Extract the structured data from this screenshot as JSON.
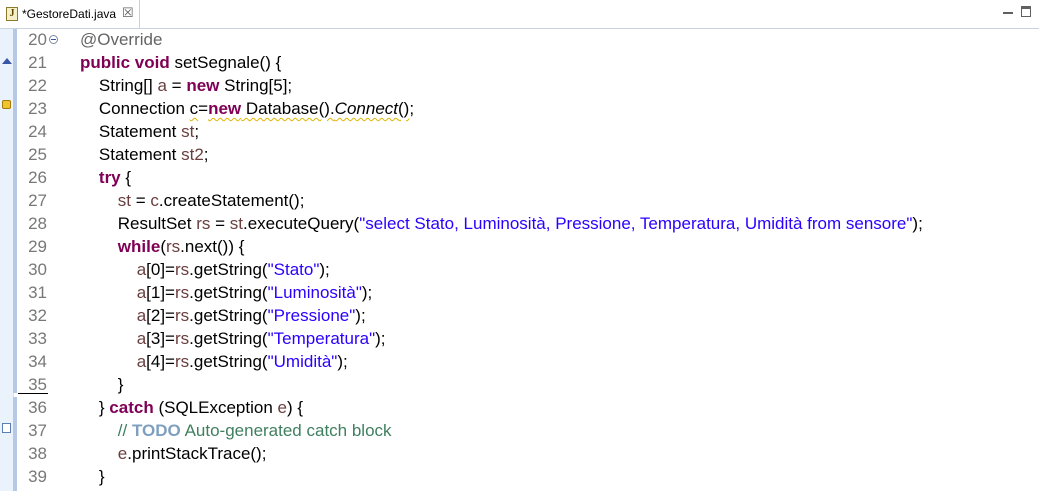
{
  "tab": {
    "title": "*GestoreDati.java",
    "icon": "java-file-icon",
    "close_glyph": "☒"
  },
  "window_controls": [
    "minimize-icon",
    "maximize-icon"
  ],
  "lines": [
    {
      "num": "20",
      "fold": true,
      "tokens": [
        [
          "ann",
          "@Override"
        ]
      ]
    },
    {
      "num": "21",
      "tokens": [
        [
          "kw",
          "public"
        ],
        [
          "",
          " "
        ],
        [
          "kw",
          "void"
        ],
        [
          "",
          " setSegnale() {"
        ]
      ]
    },
    {
      "num": "22",
      "tokens": [
        [
          "",
          "    String[] "
        ],
        [
          "var",
          "a"
        ],
        [
          "",
          " = "
        ],
        [
          "kw",
          "new"
        ],
        [
          "",
          " String[5];"
        ]
      ]
    },
    {
      "num": "23",
      "tokens": [
        [
          "",
          "    Connection "
        ],
        [
          "squig",
          "c"
        ],
        [
          "",
          "="
        ],
        [
          "kw squig",
          "new"
        ],
        [
          "squig",
          " Database()."
        ],
        [
          "ital squig",
          "Connect"
        ],
        [
          "squig",
          "()"
        ],
        [
          "",
          ";"
        ]
      ]
    },
    {
      "num": "24",
      "tokens": [
        [
          "",
          "    Statement "
        ],
        [
          "var",
          "st"
        ],
        [
          "",
          ";"
        ]
      ]
    },
    {
      "num": "25",
      "tokens": [
        [
          "",
          "    Statement "
        ],
        [
          "var",
          "st2"
        ],
        [
          "",
          ";"
        ]
      ]
    },
    {
      "num": "26",
      "tokens": [
        [
          "",
          "    "
        ],
        [
          "kw",
          "try"
        ],
        [
          "",
          " {"
        ]
      ]
    },
    {
      "num": "27",
      "tokens": [
        [
          "",
          "        "
        ],
        [
          "var",
          "st"
        ],
        [
          "",
          " = "
        ],
        [
          "var",
          "c"
        ],
        [
          "",
          ".createStatement();"
        ]
      ]
    },
    {
      "num": "28",
      "tokens": [
        [
          "",
          "        ResultSet "
        ],
        [
          "var",
          "rs"
        ],
        [
          "",
          " = "
        ],
        [
          "var",
          "st"
        ],
        [
          "",
          ".executeQuery("
        ],
        [
          "str",
          "\"select Stato, Luminosità, Pressione, Temperatura, Umidità from sensore\""
        ],
        [
          "",
          ");"
        ]
      ]
    },
    {
      "num": "29",
      "tokens": [
        [
          "",
          "        "
        ],
        [
          "kw",
          "while"
        ],
        [
          "",
          "("
        ],
        [
          "var",
          "rs"
        ],
        [
          "",
          ".next()) {"
        ]
      ]
    },
    {
      "num": "30",
      "tokens": [
        [
          "",
          "            "
        ],
        [
          "var",
          "a"
        ],
        [
          "",
          "[0]="
        ],
        [
          "var",
          "rs"
        ],
        [
          "",
          ".getString("
        ],
        [
          "str",
          "\"Stato\""
        ],
        [
          "",
          ");"
        ]
      ]
    },
    {
      "num": "31",
      "tokens": [
        [
          "",
          "            "
        ],
        [
          "var",
          "a"
        ],
        [
          "",
          "[1]="
        ],
        [
          "var",
          "rs"
        ],
        [
          "",
          ".getString("
        ],
        [
          "str",
          "\"Luminosità\""
        ],
        [
          "",
          ");"
        ]
      ]
    },
    {
      "num": "32",
      "tokens": [
        [
          "",
          "            "
        ],
        [
          "var",
          "a"
        ],
        [
          "",
          "[2]="
        ],
        [
          "var",
          "rs"
        ],
        [
          "",
          ".getString("
        ],
        [
          "str",
          "\"Pressione\""
        ],
        [
          "",
          ");"
        ]
      ]
    },
    {
      "num": "33",
      "tokens": [
        [
          "",
          "            "
        ],
        [
          "var",
          "a"
        ],
        [
          "",
          "[3]="
        ],
        [
          "var",
          "rs"
        ],
        [
          "",
          ".getString("
        ],
        [
          "str",
          "\"Temperatura\""
        ],
        [
          "",
          ");"
        ]
      ]
    },
    {
      "num": "34",
      "tokens": [
        [
          "",
          "            "
        ],
        [
          "var",
          "a"
        ],
        [
          "",
          "[4]="
        ],
        [
          "var",
          "rs"
        ],
        [
          "",
          ".getString("
        ],
        [
          "str",
          "\"Umidità\""
        ],
        [
          "",
          ");"
        ]
      ]
    },
    {
      "num": "35",
      "tokens": [
        [
          "",
          "        }"
        ]
      ]
    },
    {
      "num": "36",
      "tokens": [
        [
          "",
          "    } "
        ],
        [
          "kw",
          "catch"
        ],
        [
          "",
          " (SQLException "
        ],
        [
          "var",
          "e"
        ],
        [
          "",
          ") {"
        ]
      ]
    },
    {
      "num": "37",
      "tokens": [
        [
          "cmt",
          "        // "
        ],
        [
          "todo",
          "TODO"
        ],
        [
          "cmt",
          " Auto-generated catch block"
        ]
      ]
    },
    {
      "num": "38",
      "tokens": [
        [
          "",
          "        "
        ],
        [
          "var",
          "e"
        ],
        [
          "",
          ".printStackTrace();"
        ]
      ]
    },
    {
      "num": "39",
      "tokens": [
        [
          "",
          "    }"
        ]
      ]
    }
  ],
  "colors": {
    "keyword": "#7f0055",
    "annotation": "#646464",
    "string": "#2a00ff",
    "local_variable": "#6a3e3e",
    "comment": "#3f7f5f",
    "todo_tag": "#7f9fbf",
    "warning_underline": "#e0b400",
    "line_number": "#787878",
    "ruler_bg": "#eaf2fb"
  },
  "ruler_markers": [
    "override-indicator-icon",
    "warning-icon",
    "task-icon"
  ]
}
